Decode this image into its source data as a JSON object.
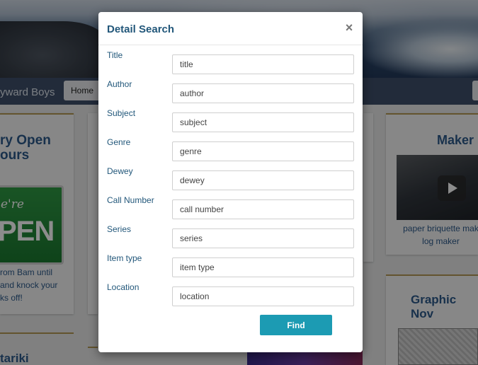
{
  "background": {
    "brand": "yward Boys",
    "nav_home": "Home",
    "left_card": {
      "title_line1": "ry Open",
      "title_line2": "ours",
      "sign_top": "e're",
      "sign_main": "PEN",
      "text_line1": "rom Bam until",
      "text_line2": "and knock your",
      "text_line3": "ks off!",
      "bottom_title": "tariki"
    },
    "right_card": {
      "title": "Maker",
      "caption_line1": "paper briquette mak",
      "caption_line2": "log maker",
      "title2": "Graphic Nov"
    }
  },
  "modal": {
    "title": "Detail Search",
    "close_label": "×",
    "fields": [
      {
        "label": "Title",
        "placeholder": "title"
      },
      {
        "label": "Author",
        "placeholder": "author"
      },
      {
        "label": "Subject",
        "placeholder": "subject"
      },
      {
        "label": "Genre",
        "placeholder": "genre"
      },
      {
        "label": "Dewey",
        "placeholder": "dewey"
      },
      {
        "label": "Call Number",
        "placeholder": "call number"
      },
      {
        "label": "Series",
        "placeholder": "series"
      },
      {
        "label": "Item type",
        "placeholder": "item type"
      },
      {
        "label": "Location",
        "placeholder": "location"
      }
    ],
    "find_label": "Find"
  }
}
